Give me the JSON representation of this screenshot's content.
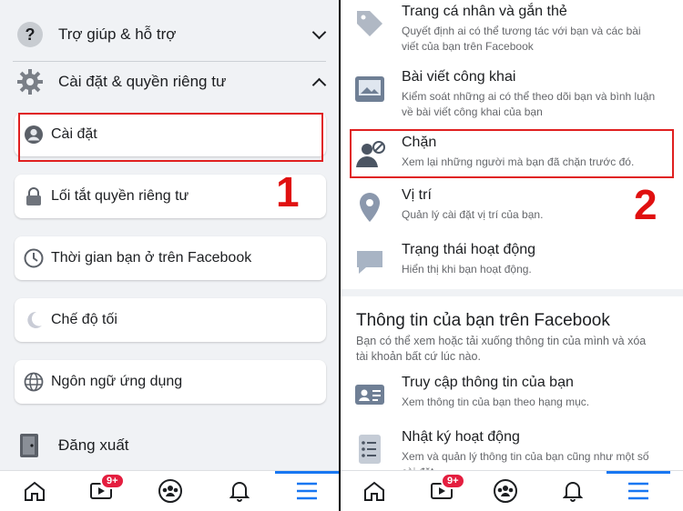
{
  "left": {
    "help_label": "Trợ giúp & hỗ trợ",
    "settings_privacy_label": "Cài đặt & quyền riêng tư",
    "cards": [
      {
        "label": "Cài đặt"
      },
      {
        "label": "Lối tắt quyền riêng tư"
      },
      {
        "label": "Thời gian bạn ở trên Facebook"
      },
      {
        "label": "Chế độ tối"
      },
      {
        "label": "Ngôn ngữ ứng dụng"
      }
    ],
    "logout_label": "Đăng xuất",
    "step_marker": "1",
    "watch_badge": "9+"
  },
  "right": {
    "items": [
      {
        "title": "Trang cá nhân và gắn thẻ",
        "subtitle": "Quyết định ai có thể tương tác với bạn và các bài viết của bạn trên Facebook"
      },
      {
        "title": "Bài viết công khai",
        "subtitle": "Kiểm soát những ai có thể theo dõi bạn và bình luận về bài viết công khai của bạn"
      },
      {
        "title": "Chặn",
        "subtitle": "Xem lại những người mà bạn đã chặn trước đó."
      },
      {
        "title": "Vị trí",
        "subtitle": "Quản lý cài đặt vị trí của bạn."
      },
      {
        "title": "Trạng thái hoạt động",
        "subtitle": "Hiển thị khi bạn hoạt động."
      }
    ],
    "section_title": "Thông tin của bạn trên Facebook",
    "section_desc": "Bạn có thể xem hoặc tải xuống thông tin của mình và xóa tài khoản bất cứ lúc nào.",
    "info_items": [
      {
        "title": "Truy cập thông tin của bạn",
        "subtitle": "Xem thông tin của bạn theo hạng mục."
      },
      {
        "title": "Nhật ký hoạt động",
        "subtitle": "Xem và quản lý thông tin của bạn cũng như một số cài đặt"
      }
    ],
    "step_marker": "2",
    "watch_badge": "9+"
  },
  "icons": {
    "home": "home-icon",
    "watch": "watch-icon",
    "groups": "groups-icon",
    "notifications": "bell-icon",
    "menu": "menu-icon"
  },
  "colors": {
    "accent": "#1877f2",
    "highlight": "#e02020",
    "badge": "#e41e3f"
  }
}
